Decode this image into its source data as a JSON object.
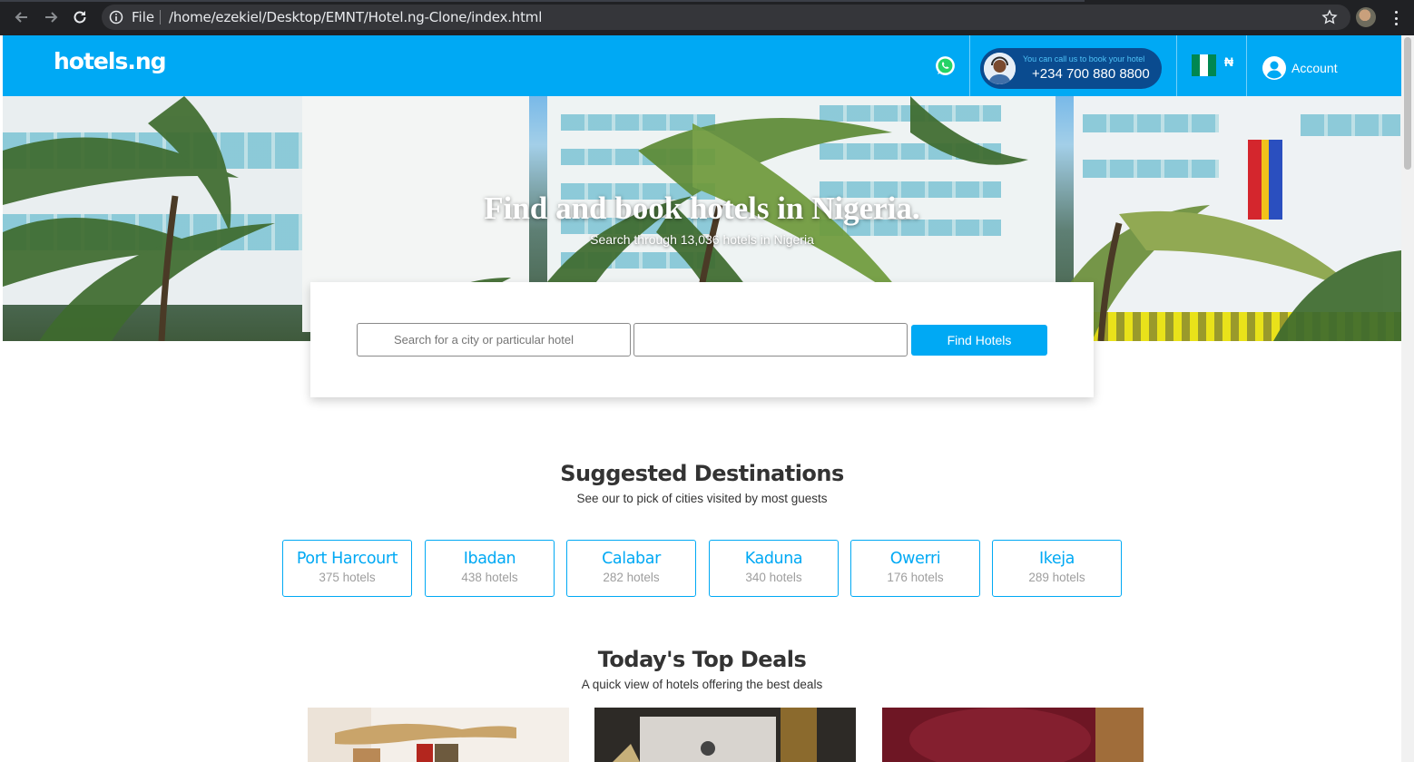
{
  "browser": {
    "file_label": "File",
    "url": "/home/ezekiel/Desktop/EMNT/Hotel.ng-Clone/index.html"
  },
  "header": {
    "logo": "hotels.ng",
    "call_hint": "You can call us to book your hotel",
    "phone": "+234 700 880 8800",
    "currency": "₦",
    "account_label": "Account",
    "brand_color": "#00a9f4",
    "call_box_color": "#0a4b8f"
  },
  "hero": {
    "title": "Find and book hotels in Nigeria.",
    "subtitle": "Search through 13,036 hotels in Nigeria"
  },
  "search": {
    "placeholder": "Search for a city or particular hotel",
    "date_value": "",
    "button_label": "Find Hotels"
  },
  "destinations": {
    "title": "Suggested Destinations",
    "subtitle": "See our to pick of cities visited by most guests",
    "items": [
      {
        "city": "Port Harcourt",
        "count": "375 hotels"
      },
      {
        "city": "Ibadan",
        "count": "438 hotels"
      },
      {
        "city": "Calabar",
        "count": "282 hotels"
      },
      {
        "city": "Kaduna",
        "count": "340 hotels"
      },
      {
        "city": "Owerri",
        "count": "176 hotels"
      },
      {
        "city": "Ikeja",
        "count": "289 hotels"
      }
    ]
  },
  "deals": {
    "title": "Today's Top Deals",
    "subtitle": "A quick view of hotels offering the best deals"
  }
}
